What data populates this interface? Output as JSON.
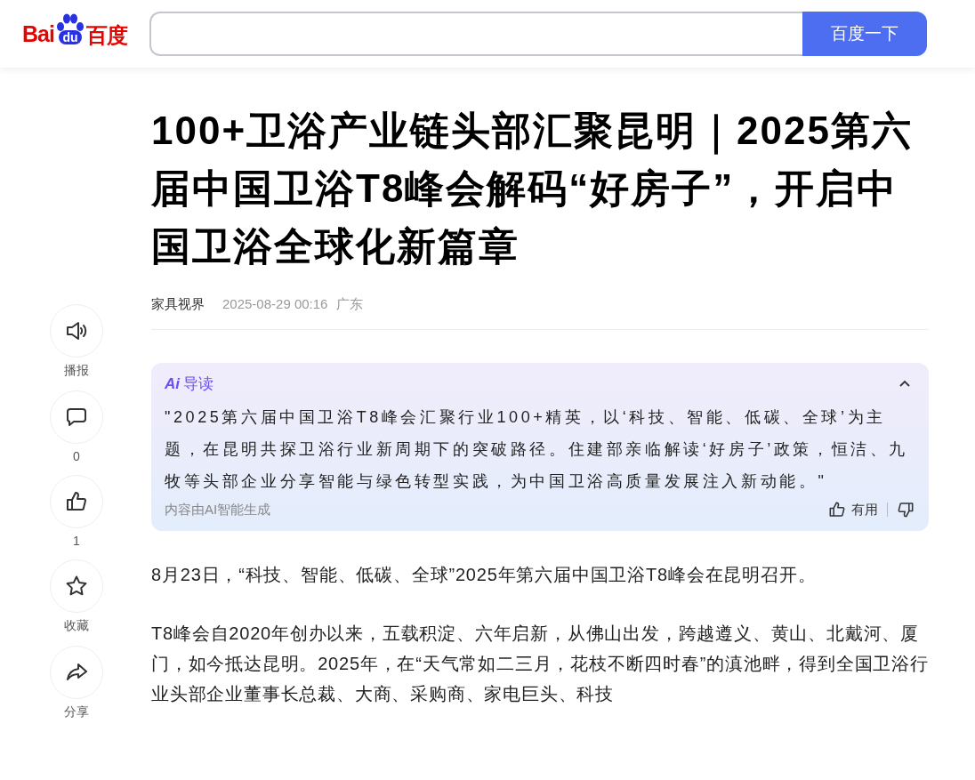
{
  "header": {
    "logo": {
      "latin": "Bai",
      "paw": "du",
      "chinese": "百度"
    },
    "search": {
      "button": "百度一下"
    }
  },
  "rail": [
    {
      "kind": "speaker",
      "label": "播报"
    },
    {
      "kind": "comment",
      "label": "0"
    },
    {
      "kind": "like",
      "label": "1"
    },
    {
      "kind": "star",
      "label": "收藏"
    },
    {
      "kind": "share",
      "label": "分享"
    }
  ],
  "article": {
    "title": "100+卫浴产业链头部汇聚昆明｜2025第六届中国卫浴T8峰会解码“好房子”，开启中国卫浴全球化新篇章",
    "source": "家具视界",
    "time": "2025-08-29 00:16",
    "region": "广东",
    "ai_summary": {
      "badge": "Ai",
      "title": "导读",
      "expanded": true,
      "text": "\"2025第六届中国卫浴T8峰会汇聚行业100+精英，以‘科技、智能、低碳、全球’为主题，在昆明共探卫浴行业新周期下的突破路径。住建部亲临解读‘好房子’政策，恒洁、九牧等头部企业分享智能与绿色转型实践，为中国卫浴高质量发展注入新动能。\"",
      "footnote": "内容由AI智能生成",
      "useful": "有用"
    },
    "paragraphs": [
      "8月23日，“科技、智能、低碳、全球”2025年第六届中国卫浴T8峰会在昆明召开。",
      "T8峰会自2020年创办以来，五载积淀、六年启新，从佛山出发，跨越遵义、黄山、北戴河、厦门，如今抵达昆明。2025年，在“天气常如二三月，花枝不断四时春”的滇池畔，得到全国卫浴行业头部企业董事长总裁、大商、采购商、家电巨头、科技"
    ]
  }
}
